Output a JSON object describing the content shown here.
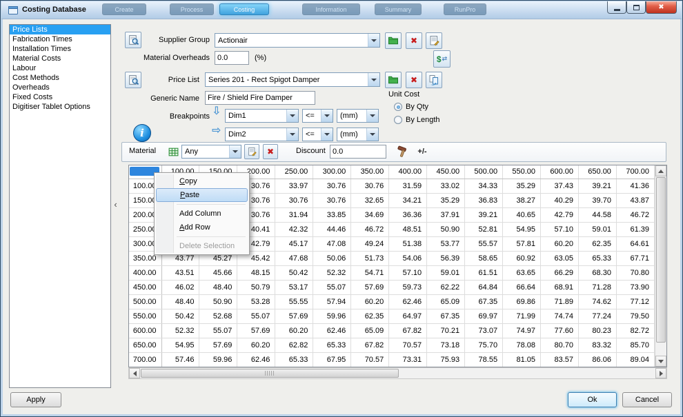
{
  "titlebar": {
    "title": "Costing Database",
    "background_tabs": [
      {
        "label": "Create",
        "active": false
      },
      {
        "label": "Process",
        "active": false
      },
      {
        "label": "Costing",
        "active": true
      },
      {
        "label": "Information",
        "active": false
      },
      {
        "label": "Summary",
        "active": false
      },
      {
        "label": "RunPro",
        "active": false
      }
    ]
  },
  "icons": {
    "close": "✖",
    "collapse": "‹",
    "down_block_arrow": "⇩",
    "right_block_arrow": "⇨",
    "delete": "✖",
    "info": "i",
    "plus_minus": "+/-",
    "currency": "$",
    "exchange": "⇄"
  },
  "sidebar": {
    "items": [
      {
        "label": "Price Lists",
        "selected": true
      },
      {
        "label": "Fabrication Times",
        "selected": false
      },
      {
        "label": "Installation Times",
        "selected": false
      },
      {
        "label": "Material Costs",
        "selected": false
      },
      {
        "label": "Labour",
        "selected": false
      },
      {
        "label": "Cost Methods",
        "selected": false
      },
      {
        "label": "Overheads",
        "selected": false
      },
      {
        "label": "Fixed Costs",
        "selected": false
      },
      {
        "label": "Digitiser Tablet Options",
        "selected": false
      }
    ]
  },
  "supplier": {
    "label": "Supplier Group",
    "value": "Actionair",
    "overheads_label": "Material Overheads",
    "overheads_value": "0.0",
    "overheads_suffix": "(%)"
  },
  "pricelist": {
    "label": "Price List",
    "value": "Series 201 - Rect Spigot Damper",
    "generic_label": "Generic Name",
    "generic_value": "Fire / Shield Fire Damper"
  },
  "unit_cost": {
    "label": "Unit Cost",
    "options": [
      {
        "label": "By Qty",
        "selected": true
      },
      {
        "label": "By Length",
        "selected": false
      }
    ]
  },
  "breakpoints": {
    "label": "Breakpoints",
    "dim1": "Dim1",
    "op1": "<=",
    "unit1": "(mm)",
    "dim2": "Dim2",
    "op2": "<=",
    "unit2": "(mm)"
  },
  "material": {
    "label": "Material",
    "value": "Any",
    "discount_label": "Discount",
    "discount_value": "0.0"
  },
  "context_menu": {
    "items": [
      {
        "label": "Copy",
        "underline": "C",
        "state": "normal"
      },
      {
        "label": "Paste",
        "underline": "P",
        "state": "highlighted"
      },
      {
        "type": "separator"
      },
      {
        "label": "Add Column",
        "underline": "",
        "state": "normal"
      },
      {
        "label": "Add Row",
        "underline": "A",
        "state": "normal"
      },
      {
        "type": "separator"
      },
      {
        "label": "Delete Selection",
        "underline": "",
        "state": "disabled"
      }
    ]
  },
  "grid": {
    "columns": [
      "100.00",
      "150.00",
      "200.00",
      "250.00",
      "300.00",
      "350.00",
      "400.00",
      "450.00",
      "500.00",
      "550.00",
      "600.00",
      "650.00",
      "700.00"
    ],
    "rows": [
      {
        "header": "100.00",
        "cells": [
          "",
          "",
          "30.76",
          "33.97",
          "30.76",
          "30.76",
          "31.59",
          "33.02",
          "34.33",
          "35.29",
          "37.43",
          "39.21",
          "41.36"
        ]
      },
      {
        "header": "150.00",
        "cells": [
          "",
          "",
          "30.76",
          "30.76",
          "30.76",
          "32.65",
          "34.21",
          "35.29",
          "36.83",
          "38.27",
          "40.29",
          "39.70",
          "43.87"
        ]
      },
      {
        "header": "200.00",
        "cells": [
          "",
          "",
          "30.76",
          "31.94",
          "33.85",
          "34.69",
          "36.36",
          "37.91",
          "39.21",
          "40.65",
          "42.79",
          "44.58",
          "46.72"
        ]
      },
      {
        "header": "250.00",
        "cells": [
          "",
          "",
          "40.41",
          "42.32",
          "44.46",
          "46.72",
          "48.51",
          "50.90",
          "52.81",
          "54.95",
          "57.10",
          "59.01",
          "61.39"
        ]
      },
      {
        "header": "300.00",
        "cells": [
          "",
          "",
          "42.79",
          "45.17",
          "47.08",
          "49.24",
          "51.38",
          "53.77",
          "55.57",
          "57.81",
          "60.20",
          "62.35",
          "64.61"
        ]
      },
      {
        "header": "350.00",
        "cells": [
          "43.77",
          "45.27",
          "45.42",
          "47.68",
          "50.06",
          "51.73",
          "54.06",
          "56.39",
          "58.65",
          "60.92",
          "63.05",
          "65.33",
          "67.71"
        ]
      },
      {
        "header": "400.00",
        "cells": [
          "43.51",
          "45.66",
          "48.15",
          "50.42",
          "52.32",
          "54.71",
          "57.10",
          "59.01",
          "61.51",
          "63.65",
          "66.29",
          "68.30",
          "70.80"
        ]
      },
      {
        "header": "450.00",
        "cells": [
          "46.02",
          "48.40",
          "50.79",
          "53.17",
          "55.07",
          "57.69",
          "59.73",
          "62.22",
          "64.84",
          "66.64",
          "68.91",
          "71.28",
          "73.90"
        ]
      },
      {
        "header": "500.00",
        "cells": [
          "48.40",
          "50.90",
          "53.28",
          "55.55",
          "57.94",
          "60.20",
          "62.46",
          "65.09",
          "67.35",
          "69.86",
          "71.89",
          "74.62",
          "77.12"
        ]
      },
      {
        "header": "550.00",
        "cells": [
          "50.42",
          "52.68",
          "55.07",
          "57.69",
          "59.96",
          "62.35",
          "64.97",
          "67.35",
          "69.97",
          "71.99",
          "74.74",
          "77.24",
          "79.50"
        ]
      },
      {
        "header": "600.00",
        "cells": [
          "52.32",
          "55.07",
          "57.69",
          "60.20",
          "62.46",
          "65.09",
          "67.82",
          "70.21",
          "73.07",
          "74.97",
          "77.60",
          "80.23",
          "82.72"
        ]
      },
      {
        "header": "650.00",
        "cells": [
          "54.95",
          "57.69",
          "60.20",
          "62.82",
          "65.33",
          "67.82",
          "70.57",
          "73.18",
          "75.70",
          "78.08",
          "80.70",
          "83.32",
          "85.70"
        ]
      },
      {
        "header": "700.00",
        "cells": [
          "57.46",
          "59.96",
          "62.46",
          "65.33",
          "67.95",
          "70.57",
          "73.31",
          "75.93",
          "78.55",
          "81.05",
          "83.57",
          "86.06",
          "89.04"
        ]
      }
    ]
  },
  "buttons": {
    "apply": "Apply",
    "ok": "Ok",
    "cancel": "Cancel"
  }
}
